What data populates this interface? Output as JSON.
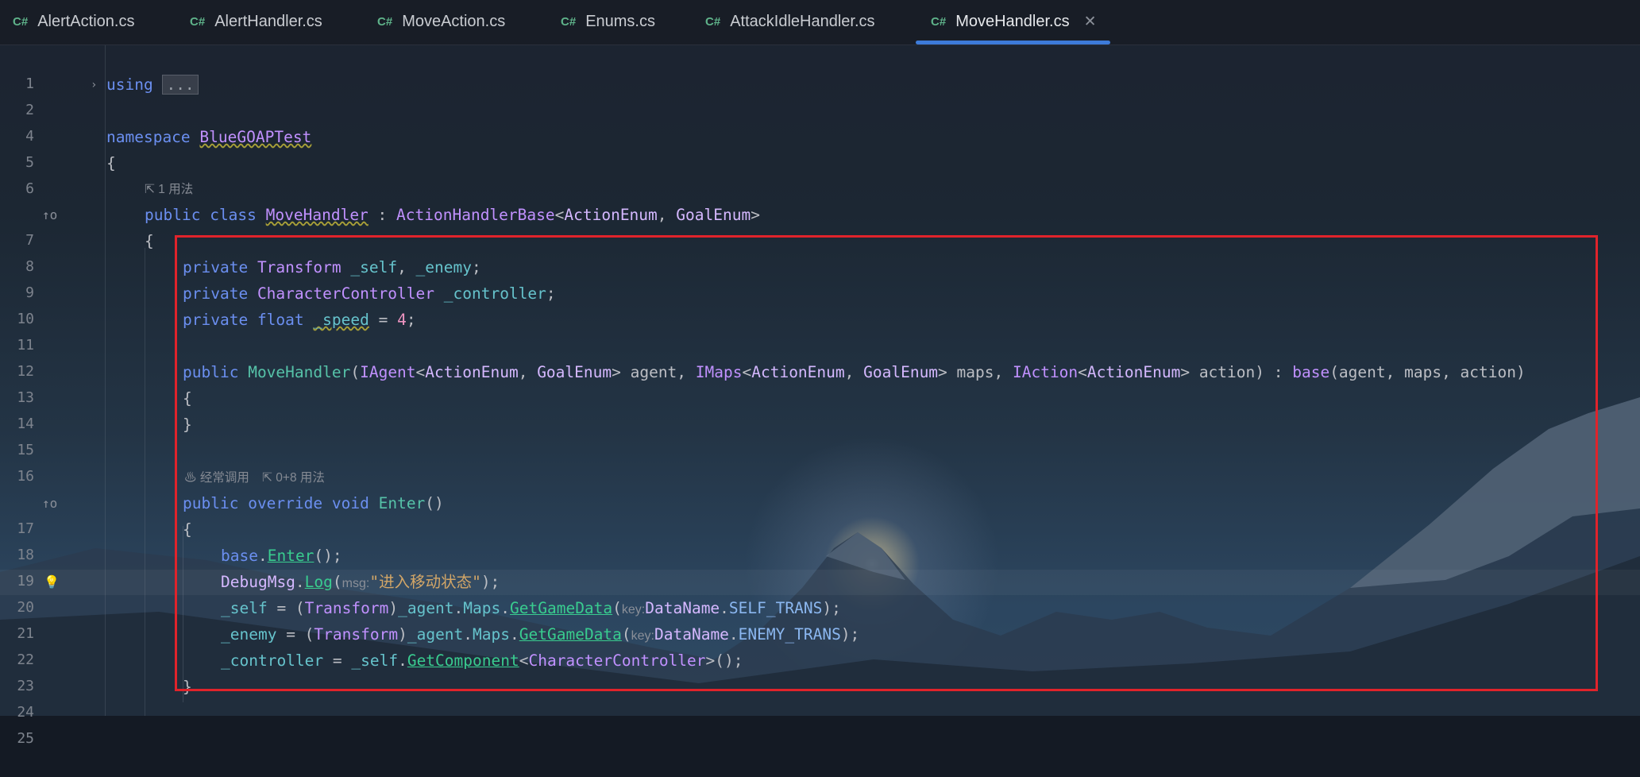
{
  "tabs": [
    {
      "badge": "C#",
      "label": "AlertAction.cs"
    },
    {
      "badge": "C#",
      "label": "AlertHandler.cs"
    },
    {
      "badge": "C#",
      "label": "MoveAction.cs"
    },
    {
      "badge": "C#",
      "label": "Enums.cs"
    },
    {
      "badge": "C#",
      "label": "AttackIdleHandler.cs"
    },
    {
      "badge": "C#",
      "label": "MoveHandler.cs",
      "active": true,
      "close": "✕"
    }
  ],
  "line_numbers": [
    "1",
    "2",
    "4",
    "5",
    "6",
    "7",
    "8",
    "9",
    "10",
    "11",
    "12",
    "13",
    "14",
    "15",
    "16",
    "17",
    "18",
    "19",
    "20",
    "21",
    "22",
    "23",
    "24",
    "25"
  ],
  "hints": {
    "class_usages": "1 用法",
    "enter_frequent": "经常调用",
    "enter_usages": "0+8 用法"
  },
  "code": {
    "kw_using": "using",
    "fold": "...",
    "kw_namespace": "namespace",
    "ns_name": "BlueGOAPTest",
    "brace_open": "{",
    "brace_close": "}",
    "l7_public": "public",
    "l7_class": "class",
    "l7_name": "MoveHandler",
    "l7_colon": " : ",
    "l7_base": "ActionHandlerBase",
    "l7_lt": "<",
    "l7_action_enum": "ActionEnum",
    "l7_comma": ", ",
    "l7_goal_enum": "GoalEnum",
    "l7_gt": ">",
    "l9_private": "private",
    "l9_type": "Transform",
    "l9_self": "_self",
    "l9_comma": ", ",
    "l9_enemy": "_enemy",
    "l9_semi": ";",
    "l10_private": "private",
    "l10_type": "CharacterController",
    "l10_field": "_controller",
    "l10_semi": ";",
    "l11_private": "private",
    "l11_float": "float",
    "l11_field": "_speed",
    "l11_eq": " = ",
    "l11_num": "4",
    "l11_semi": ";",
    "l13_public": "public",
    "l13_name": "MoveHandler",
    "l13_paren": "(",
    "l13_iagent": "IAgent",
    "l13_lt1": "<",
    "l13_ae1": "ActionEnum",
    "l13_c1": ", ",
    "l13_ge1": "GoalEnum",
    "l13_gt1": ">",
    "l13_agent": " agent, ",
    "l13_imaps": "IMaps",
    "l13_lt2": "<",
    "l13_ae2": "ActionEnum",
    "l13_c2": ", ",
    "l13_ge2": "GoalEnum",
    "l13_gt2": ">",
    "l13_maps": " maps, ",
    "l13_iaction": "IAction",
    "l13_lt3": "<",
    "l13_ae3": "ActionEnum",
    "l13_gt3": ">",
    "l13_action": " action) : ",
    "l13_base": "base",
    "l13_args": "(agent, maps, action)",
    "l17_public": "public",
    "l17_override": "override",
    "l17_void": "void",
    "l17_enter": "Enter",
    "l17_parens": "()",
    "l19_base": "base",
    "l19_dot": ".",
    "l19_enter": "Enter",
    "l19_rest": "();",
    "l20_debug": "DebugMsg",
    "l20_dot": ".",
    "l20_log": "Log",
    "l20_paren": "(",
    "l20_hint": "msg:",
    "l20_str": "\"进入移动状态\"",
    "l20_end": ");",
    "l21_self": "_self",
    "l21_eq": " = (",
    "l21_type": "Transform",
    "l21_cast": ")",
    "l21_agent": "_agent",
    "l21_dot1": ".",
    "l21_maps": "Maps",
    "l21_dot2": ".",
    "l21_get": "GetGameData",
    "l21_paren": "(",
    "l21_hint": "key:",
    "l21_dn": "DataName",
    "l21_dot3": ".",
    "l21_const": "SELF_TRANS",
    "l21_end": ");",
    "l22_enemy": "_enemy",
    "l22_eq": " = (",
    "l22_type": "Transform",
    "l22_cast": ")",
    "l22_agent": "_agent",
    "l22_dot1": ".",
    "l22_maps": "Maps",
    "l22_dot2": ".",
    "l22_get": "GetGameData",
    "l22_paren": "(",
    "l22_hint": "key:",
    "l22_dn": "DataName",
    "l22_dot3": ".",
    "l22_const": "ENEMY_TRANS",
    "l22_end": ");",
    "l23_ctrl": "_controller",
    "l23_eq": " = ",
    "l23_self": "_self",
    "l23_dot": ".",
    "l23_get": "GetComponent",
    "l23_lt": "<",
    "l23_type": "CharacterController",
    "l23_end": ">();"
  },
  "gutter_icons": {
    "line7": "implemented-up-icon",
    "line17": "override-up-icon",
    "line20": "lightbulb-icon"
  },
  "colors": {
    "highlight_box": "#e0232b",
    "active_tab_underline": "#3d7bd9"
  }
}
